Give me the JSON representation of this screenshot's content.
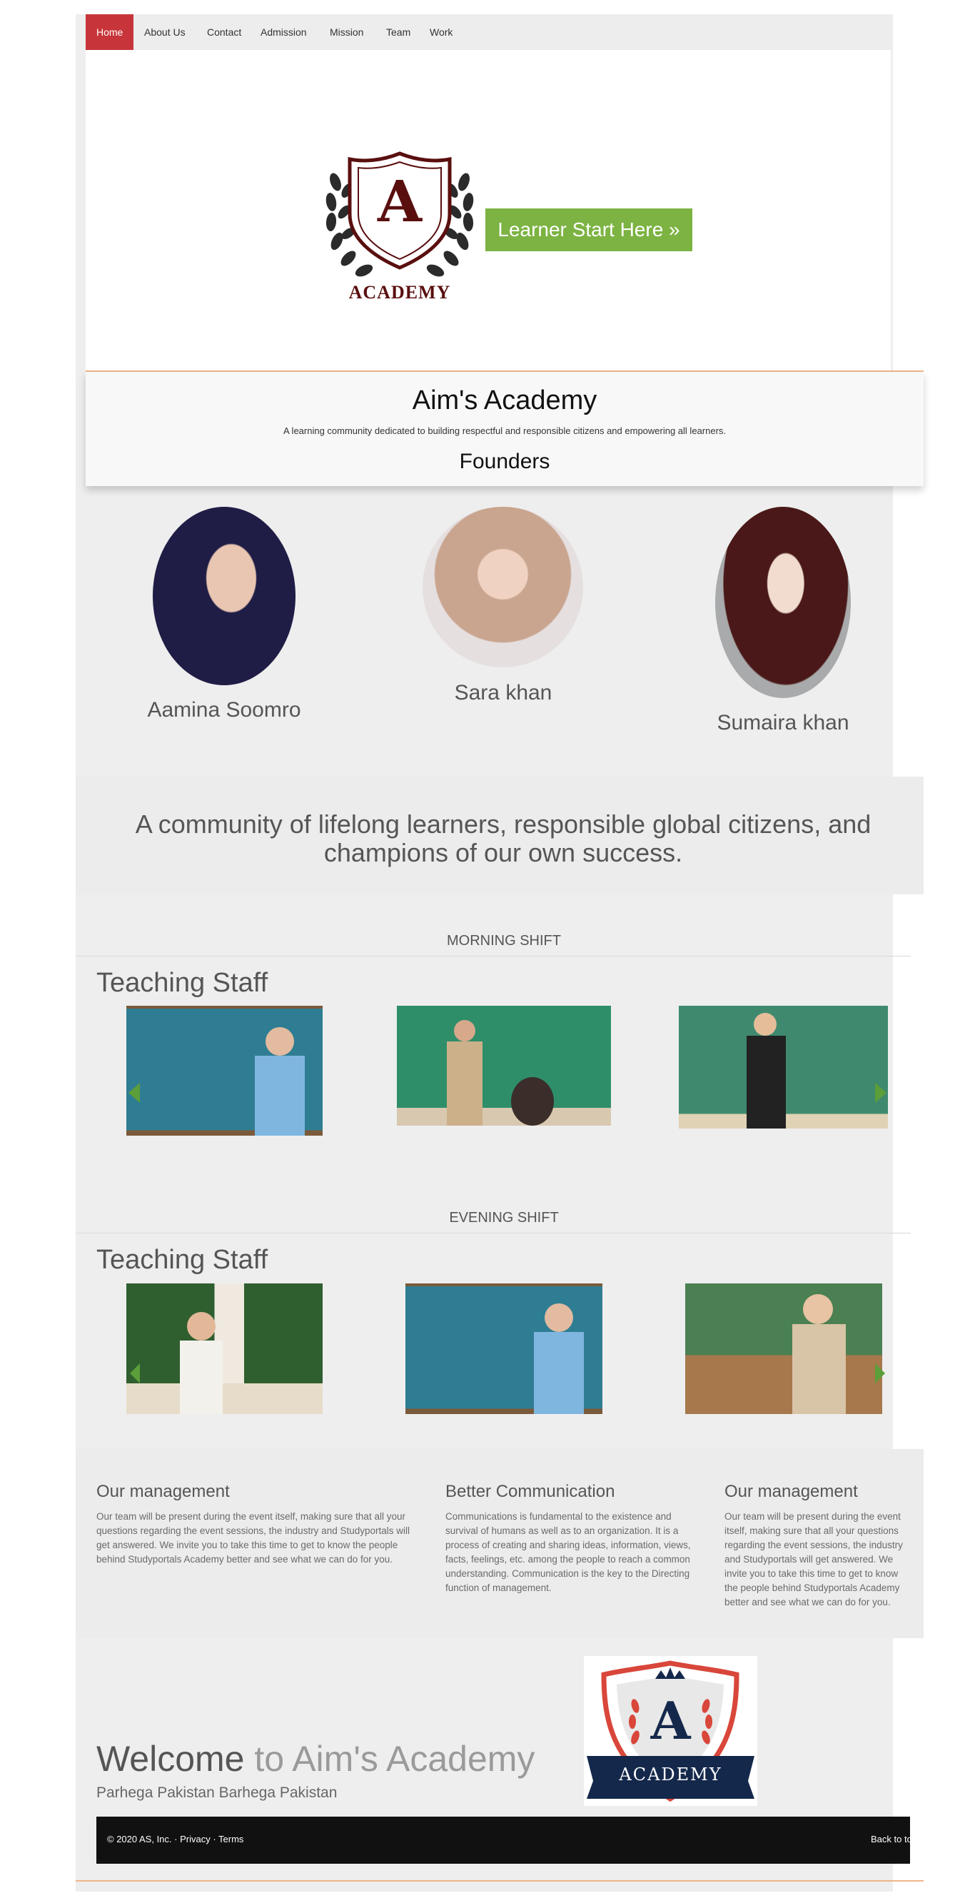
{
  "nav": {
    "items": [
      "Home",
      "About Us",
      "Contact",
      "Admission",
      "Mission",
      "Team",
      "Work"
    ],
    "active": "Home"
  },
  "hero": {
    "logo_text": "ACADEMY",
    "logo_letter": "A",
    "cta_label": "Learner Start Here »"
  },
  "intro": {
    "title": "Aim's Academy",
    "tagline": "A learning community dedicated to building respectful and responsible citizens and empowering all learners.",
    "founders_heading": "Founders"
  },
  "founders": [
    {
      "name": "Aamina Soomro"
    },
    {
      "name": "Sara khan"
    },
    {
      "name": "Sumaira khan"
    }
  ],
  "quote": "A community of lifelong learners, responsible global citizens, and champions of our own success.",
  "morning": {
    "shift_label": "MORNING SHIFT",
    "heading": "Teaching Staff"
  },
  "evening": {
    "shift_label": "EVENING SHIFT",
    "heading": "Teaching Staff"
  },
  "columns": [
    {
      "title": "Our management",
      "text": "Our team will be present during the event itself, making sure that all your questions regarding the event sessions, the industry and Studyportals will get answered. We invite you to take this time to get to know the people behind Studyportals Academy better and see what we can do for you."
    },
    {
      "title": "Better Communication",
      "text": "Communications is fundamental to the existence and survival of humans as well as to an organization. It is a process of creating and sharing ideas, information, views, facts, feelings, etc. among the people to reach a common understanding. Communication is the key to the Directing function of management."
    },
    {
      "title": "Our management",
      "text": "Our team will be present during the event itself, making sure that all your questions regarding the event sessions, the industry and Studyportals will get answered. We invite you to take this time to get to know the people behind Studyportals Academy better and see what we can do for you."
    }
  ],
  "welcome": {
    "lead": "Welcome",
    "rest": " to Aim's Academy",
    "sub": "Parhega Pakistan Barhega Pakistan",
    "badge_text": "ACADEMY",
    "badge_letter": "A"
  },
  "footer": {
    "copyright": "© 2020 AS, Inc. · ",
    "privacy": "Privacy",
    "sep": " · ",
    "terms": "Terms",
    "back": "Back to top"
  },
  "colors": {
    "accent_red": "#c7353a",
    "cta_green": "#7cb342",
    "logo_maroon": "#5a0f0f",
    "badge_navy": "#14284b"
  }
}
